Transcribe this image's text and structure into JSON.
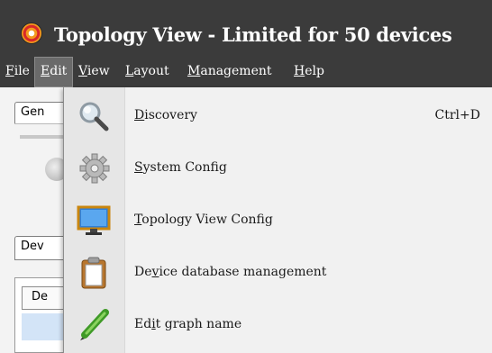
{
  "window": {
    "title": "Topology View - Limited for 50 devices"
  },
  "menubar": {
    "items": [
      {
        "underline": "F",
        "rest": "ile"
      },
      {
        "underline": "E",
        "rest": "dit"
      },
      {
        "underline": "V",
        "rest": "iew"
      },
      {
        "underline": "L",
        "rest": "ayout"
      },
      {
        "underline": "M",
        "rest": "anagement"
      },
      {
        "underline": "H",
        "rest": "elp"
      }
    ]
  },
  "background": {
    "tab_top": "Gen",
    "tab_lower": "Dev",
    "column_header": "De"
  },
  "edit_menu": {
    "items": [
      {
        "pre": "",
        "u": "D",
        "post": "iscovery",
        "shortcut": "Ctrl+D",
        "icon": "magnifier-icon"
      },
      {
        "pre": "",
        "u": "S",
        "post": "ystem Config",
        "shortcut": "",
        "icon": "gear-icon"
      },
      {
        "pre": "",
        "u": "T",
        "post": "opology View Config",
        "shortcut": "",
        "icon": "monitor-icon"
      },
      {
        "pre": "De",
        "u": "v",
        "post": "ice database management",
        "shortcut": "",
        "icon": "clipboard-icon"
      },
      {
        "pre": "Ed",
        "u": "i",
        "post": "t graph name",
        "shortcut": "",
        "icon": "pen-icon"
      }
    ]
  },
  "colors": {
    "titlebar_bg": "#3b3b3b",
    "menu_active_bg": "#6a6a6a",
    "dropdown_bg": "#f1f1f1",
    "selection_blue": "#d3e4f7"
  }
}
